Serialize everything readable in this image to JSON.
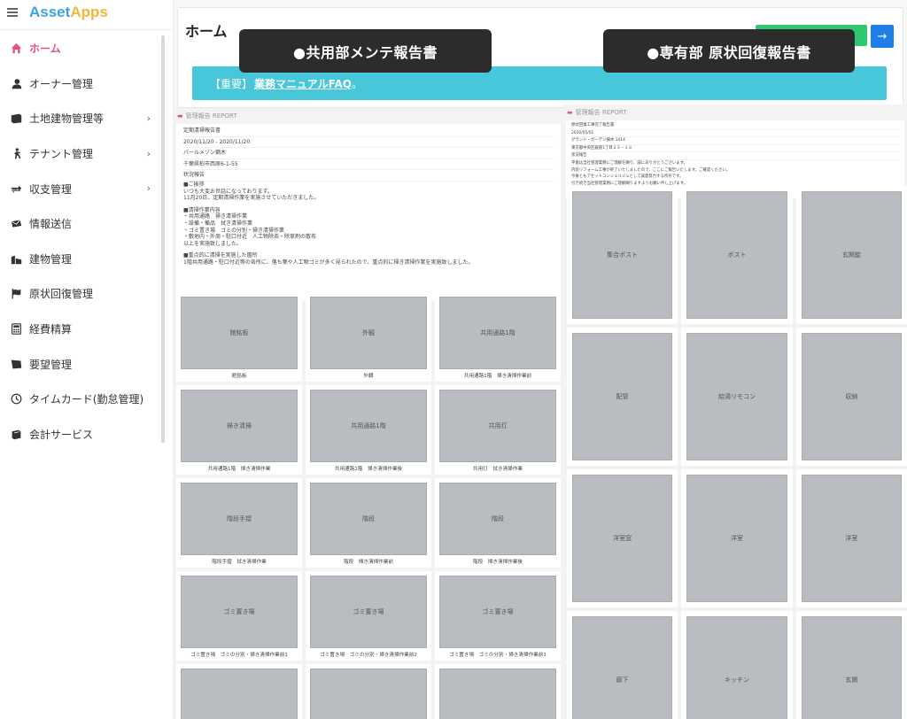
{
  "app": {
    "logo_part1": "Asset",
    "logo_part2": "Apps"
  },
  "sidebar": {
    "items": [
      {
        "label": "ホーム",
        "icon": "home-icon",
        "active": true
      },
      {
        "label": "オーナー管理",
        "icon": "user-icon"
      },
      {
        "label": "土地建物管理等",
        "icon": "building-icon",
        "chevron": "›"
      },
      {
        "label": "テナント管理",
        "icon": "person-walking-icon",
        "chevron": "›"
      },
      {
        "label": "収支管理",
        "icon": "exchange-icon",
        "chevron": "›"
      },
      {
        "label": "情報送信",
        "icon": "envelope-icon"
      },
      {
        "label": "建物管理",
        "icon": "city-icon"
      },
      {
        "label": "原状回復管理",
        "icon": "flag-icon"
      },
      {
        "label": "経費精算",
        "icon": "calculator-icon"
      },
      {
        "label": "要望管理",
        "icon": "flag-solid-icon"
      },
      {
        "label": "タイムカード(勤怠管理)",
        "icon": "clock-icon"
      },
      {
        "label": "会計サービス",
        "icon": "book-icon"
      }
    ]
  },
  "header": {
    "title": "ホーム",
    "arrow_glyph": "→",
    "notice_prefix": "【重要】",
    "notice_link": "業務マニュアルFAQ",
    "notice_suffix": "。"
  },
  "callouts": {
    "left": "●共用部メンテ報告書",
    "right": "●専有部 原状回復報告書"
  },
  "report_left": {
    "label": "管理報告 REPORT",
    "lines": [
      "定期清掃報告書",
      "2020/11/20 - 2020/11/20",
      "パールメゾン鏑木",
      "千葉県柏市西原6-1-55",
      "状況報告"
    ],
    "body": [
      "■ご挨拶",
      "いつも大変お世話になっております。",
      "11月20日、定期清掃作業を実施させていただきました。",
      "",
      "■清掃作業内容",
      "・共用通路　掃き清掃作業",
      "・設備・備品　拭き清掃作業",
      "・ゴミ置き場　ゴミの分別・掃き清掃作業",
      "・敷地内・外周・駐口付近　人工物除去・除草剤の散布",
      "以上を実施致しました。",
      "",
      "■重点的に清掃を実施した箇所",
      "1階共用通路・駐口付近等の各所に、落ち葉や人工物ゴミが多く見られたので、重点的に掃き清掃作業を実施致しました。"
    ],
    "photos": [
      {
        "caption": "館銘板",
        "alt": "館銘板"
      },
      {
        "caption": "外観",
        "alt": "外観"
      },
      {
        "caption": "共用通路1階　掃き清掃作業前",
        "alt": "共用通路1階"
      },
      {
        "caption": "共用通路1階　掃き清掃作業",
        "alt": "掃き清掃"
      },
      {
        "caption": "共用通路1階　掃き清掃作業後",
        "alt": "共用通路1階"
      },
      {
        "caption": "共用灯　拭き清掃作業",
        "alt": "共用灯"
      },
      {
        "caption": "階段手摺　拭き清掃作業",
        "alt": "階段手摺"
      },
      {
        "caption": "階段　掃き清掃作業前",
        "alt": "階段"
      },
      {
        "caption": "階段　掃き清掃作業後",
        "alt": "階段"
      },
      {
        "caption": "ゴミ置き場　ゴミの分別・掃き清掃作業前1",
        "alt": "ゴミ置き場"
      },
      {
        "caption": "ゴミ置き場　ゴミの分別・掃き清掃作業前2",
        "alt": "ゴミ置き場"
      },
      {
        "caption": "ゴミ置き場　ゴミの分別・掃き清掃作業前1",
        "alt": "ゴミ置き場"
      },
      {
        "caption": "",
        "alt": ""
      },
      {
        "caption": "",
        "alt": ""
      },
      {
        "caption": "",
        "alt": ""
      }
    ]
  },
  "report_right": {
    "label": "管理報告 REPORT",
    "lines": [
      "原状回復工事完了報告書",
      "2020/05/01",
      "グランド・ガーデン鏑木 1414",
      "東京都中央区銀座1丁目２３－１８",
      "状況報告",
      "平素は当社管理業務にご理解を賜り、誠にありがとうございます。",
      "内装リフォーム工事が終了いたしましたので、ここにご報告いたします。ご確認ください。",
      "今後ともアセットコンシェルジュとして誠意努力する所存です。",
      "引き続き当社管理業務にご理解賜りますようお願い申し上げます。"
    ],
    "photos": [
      {
        "alt": "集合ポスト"
      },
      {
        "alt": "ポスト"
      },
      {
        "alt": "玄関錠"
      },
      {
        "alt": "配管"
      },
      {
        "alt": "給湯リモコン"
      },
      {
        "alt": "収納"
      },
      {
        "alt": "洋室窓"
      },
      {
        "alt": "洋室"
      },
      {
        "alt": "洋室"
      },
      {
        "alt": "廊下"
      },
      {
        "alt": "キッチン"
      },
      {
        "alt": "玄関"
      }
    ]
  }
}
